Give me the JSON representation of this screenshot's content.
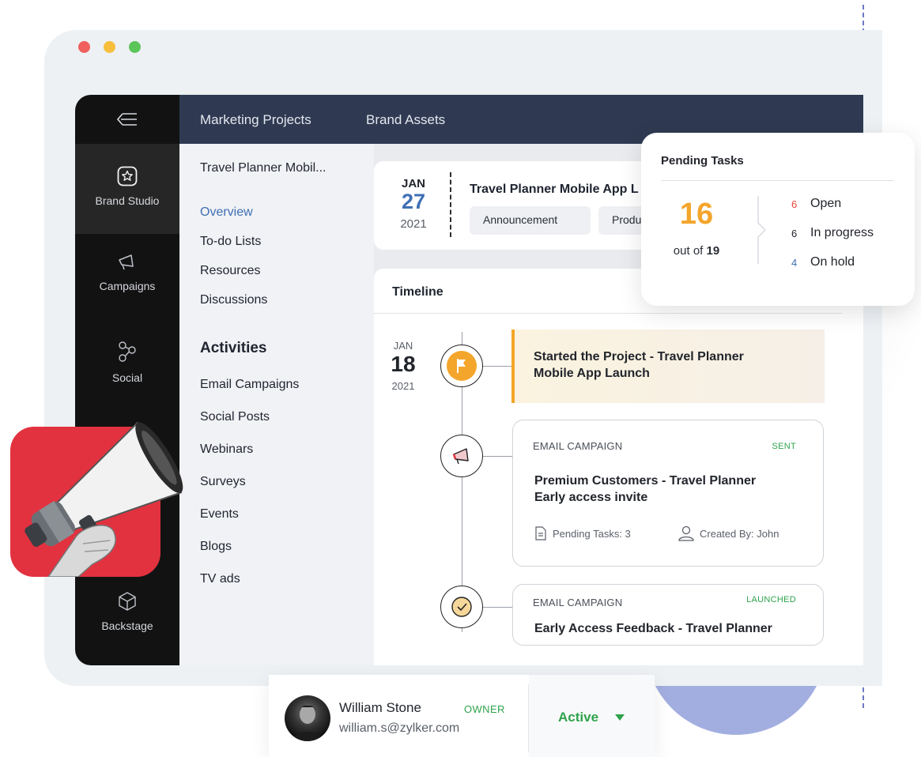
{
  "sidebar": {
    "items": [
      {
        "label": "Brand Studio",
        "icon": "star-badge-icon"
      },
      {
        "label": "Campaigns",
        "icon": "megaphone-icon"
      },
      {
        "label": "Social",
        "icon": "share-network-icon"
      },
      {
        "label": "Backstage",
        "icon": "cube-icon"
      }
    ]
  },
  "topbar": {
    "tabs": [
      {
        "label": "Marketing Projects"
      },
      {
        "label": "Brand Assets"
      }
    ]
  },
  "subnav": {
    "project_name": "Travel Planner Mobil...",
    "links": [
      "Overview",
      "To-do Lists",
      "Resources",
      "Discussions"
    ],
    "activities_heading": "Activities",
    "activities": [
      "Email Campaigns",
      "Social Posts",
      "Webinars",
      "Surveys",
      "Events",
      "Blogs",
      "TV ads"
    ]
  },
  "project": {
    "month": "JAN",
    "day": "27",
    "year": "2021",
    "title": "Travel Planner Mobile App L",
    "tags": [
      "Announcement",
      "Produ"
    ]
  },
  "timeline": {
    "heading": "Timeline",
    "date": {
      "month": "JAN",
      "day": "18",
      "year": "2021"
    },
    "started": {
      "line1": "Started the Project - Travel Planner",
      "line2": "Mobile App Launch"
    },
    "events": [
      {
        "kind": "EMAIL CAMPAIGN",
        "status": "SENT",
        "title_line1": "Premium Customers - Travel Planner",
        "title_line2": "Early access invite",
        "pending": "Pending Tasks: 3",
        "created_by": "Created By: John"
      },
      {
        "kind": "EMAIL CAMPAIGN",
        "status": "LAUNCHED",
        "title_line1": "Early Access Feedback - Travel Planner"
      }
    ]
  },
  "pending_tasks": {
    "title": "Pending Tasks",
    "count": "16",
    "out_of_label": "out of",
    "total": "19",
    "breakdown": [
      {
        "count": "6",
        "label": "Open",
        "color": "#e8453c"
      },
      {
        "count": "6",
        "label": "In progress",
        "color": "#22252c"
      },
      {
        "count": "4",
        "label": "On hold",
        "color": "#3f6fb5"
      }
    ]
  },
  "user": {
    "name": "William Stone",
    "email": "william.s@zylker.com",
    "role": "OWNER",
    "status": "Active"
  },
  "colors": {
    "accent_orange": "#f4a52b",
    "accent_blue": "#3f6fb5",
    "success_green": "#2fa34c",
    "topbar": "#2f3a52",
    "sidebar": "#121212",
    "megaphone_bg": "#e2323f"
  }
}
